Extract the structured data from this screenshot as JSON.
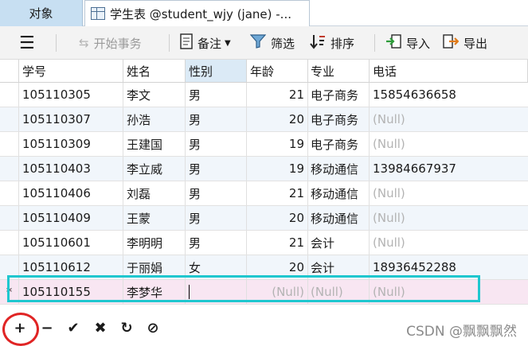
{
  "tabs": {
    "objects": "对象",
    "table": "学生表 @student_wjy (jane) -..."
  },
  "toolbar": {
    "menu_icon": "hamburger-icon",
    "begin_transaction": "开始事务",
    "comment": "备注",
    "filter": "筛选",
    "sort": "排序",
    "import": "导入",
    "export": "导出"
  },
  "columns": [
    "学号",
    "姓名",
    "性别",
    "年龄",
    "专业",
    "电话"
  ],
  "rows": [
    {
      "id": "105110305",
      "name": "李文",
      "gender": "男",
      "age": "21",
      "major": "电子商务",
      "phone": "15854636658"
    },
    {
      "id": "105110307",
      "name": "孙浩",
      "gender": "男",
      "age": "20",
      "major": "电子商务",
      "phone": "(Null)"
    },
    {
      "id": "105110309",
      "name": "王建国",
      "gender": "男",
      "age": "19",
      "major": "电子商务",
      "phone": "(Null)"
    },
    {
      "id": "105110403",
      "name": "李立威",
      "gender": "男",
      "age": "19",
      "major": "移动通信",
      "phone": "13984667937"
    },
    {
      "id": "105110406",
      "name": "刘磊",
      "gender": "男",
      "age": "21",
      "major": "移动通信",
      "phone": "(Null)"
    },
    {
      "id": "105110409",
      "name": "王蒙",
      "gender": "男",
      "age": "20",
      "major": "移动通信",
      "phone": "(Null)"
    },
    {
      "id": "105110601",
      "name": "李明明",
      "gender": "男",
      "age": "21",
      "major": "会计",
      "phone": "(Null)"
    },
    {
      "id": "105110612",
      "name": "于丽娟",
      "gender": "女",
      "age": "20",
      "major": "会计",
      "phone": "18936452288"
    }
  ],
  "new_row": {
    "marker": "*",
    "id": "105110155",
    "name": "李梦华",
    "gender": "",
    "age": "(Null)",
    "major": "(Null)",
    "phone": "(Null)"
  },
  "bottom_toolbar": {
    "add": "+",
    "delete": "−",
    "apply": "✔",
    "discard": "✖",
    "refresh": "↻",
    "stop": "⊘"
  },
  "watermark": "CSDN @飘飘飘然",
  "colors": {
    "highlight_box": "#1fc7cf",
    "annotation_circle": "#e02424",
    "new_row_bg": "#f8e6f2",
    "null_text": "#b3b3b3"
  }
}
